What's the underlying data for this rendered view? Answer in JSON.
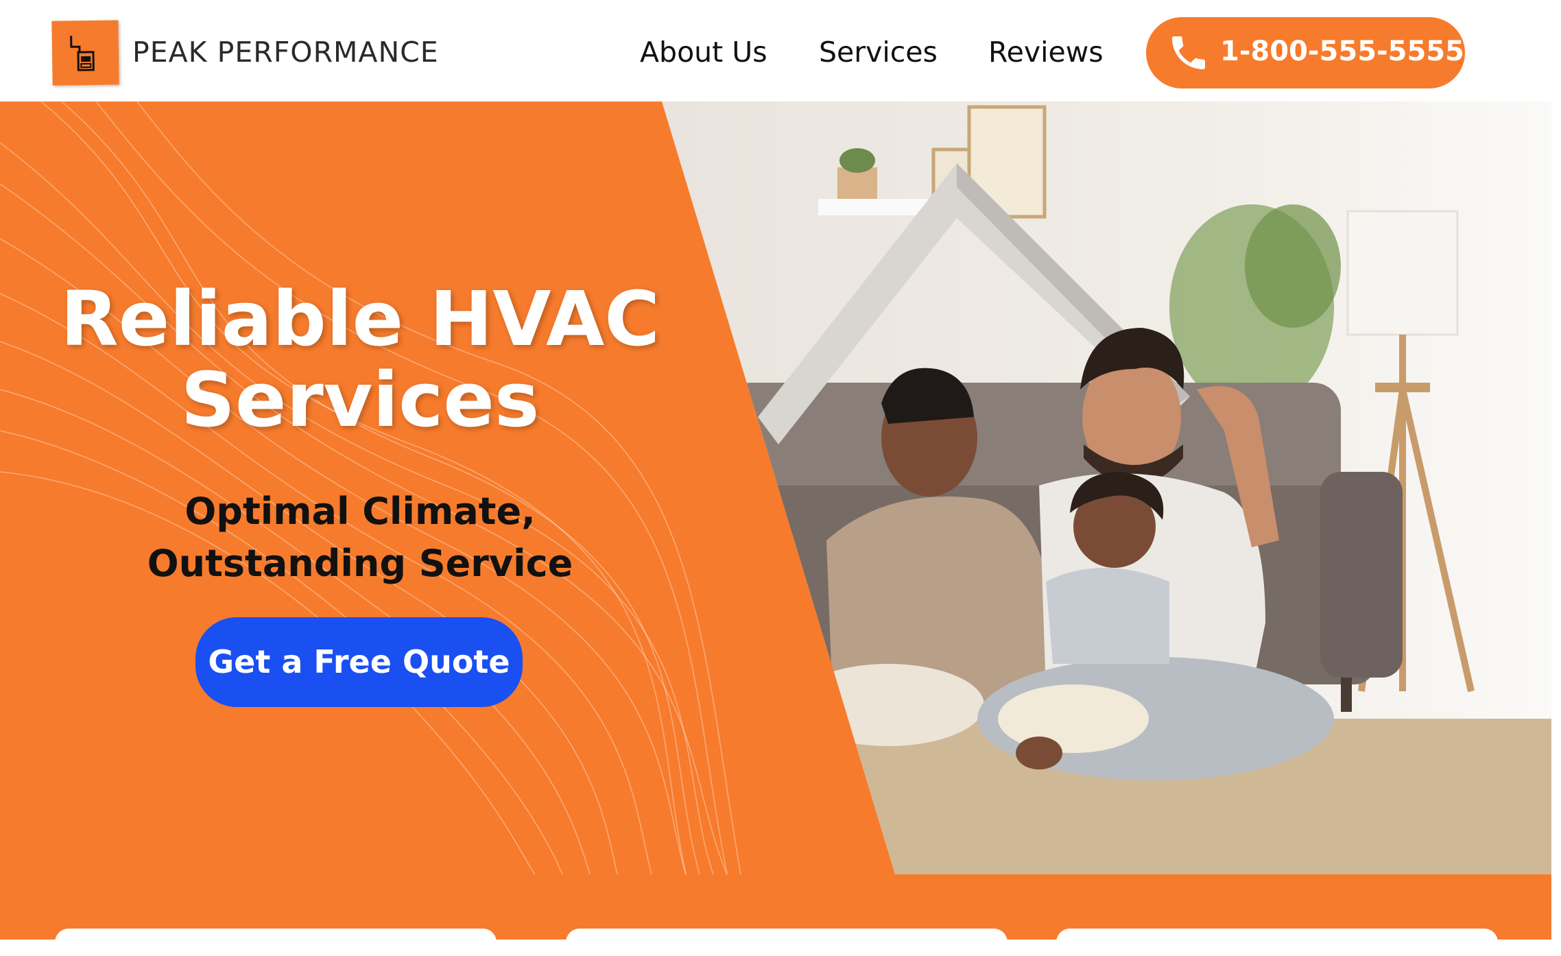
{
  "header": {
    "brand": "PEAK PERFORMANCE",
    "logo_icon": "hvac-unit-icon",
    "nav": [
      {
        "label": "About Us"
      },
      {
        "label": "Services"
      },
      {
        "label": "Reviews"
      }
    ],
    "phone": {
      "label": "1-800-555-5555",
      "icon": "phone-icon"
    }
  },
  "hero": {
    "title": "Reliable HVAC Services",
    "subtitle": "Optimal Climate, Outstanding Service",
    "cta_label": "Get a Free Quote",
    "image_description_icon": "family-under-roof-photo"
  },
  "colors": {
    "accent_orange": "#f77b2c",
    "cta_blue": "#1a4ff2",
    "text_dark": "#111111",
    "white": "#ffffff"
  }
}
